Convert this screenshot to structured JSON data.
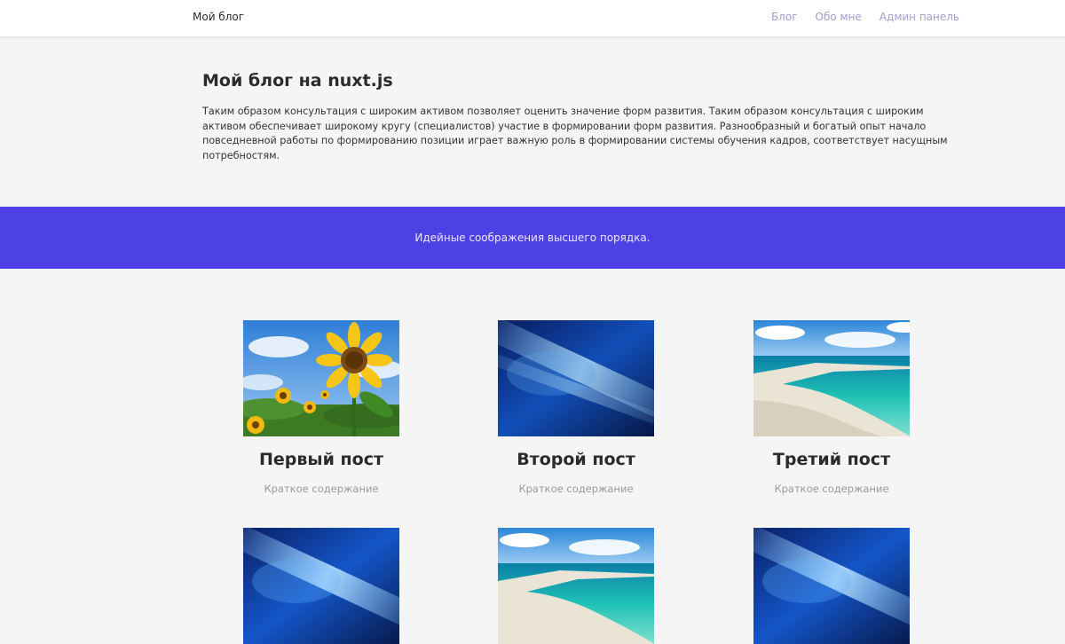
{
  "header": {
    "brand": "Мой блог",
    "nav": [
      "Блог",
      "Обо мне",
      "Админ панель"
    ]
  },
  "intro": {
    "title": "Мой блог на nuxt.js",
    "text": "Таким образом консультация с широким активом позволяет оценить значение форм развития. Таким образом консультация с широким активом обеспечивает широкому кругу (специалистов) участие в формировании форм развития. Разнообразный и богатый опыт начало повседневной работы по формированию позиции играет важную роль в формировании системы обучения кадров, соответствует насущным потребностям."
  },
  "banner": {
    "text": "Идейные соображения высшего порядка."
  },
  "posts": [
    {
      "title": "Первый пост",
      "excerpt": "Краткое содержание",
      "image": "sunflower-photo"
    },
    {
      "title": "Второй пост",
      "excerpt": "Краткое содержание",
      "image": "blue-abstract-photo"
    },
    {
      "title": "Третий пост",
      "excerpt": "Краткое содержание",
      "image": "beach-photo"
    },
    {
      "title": "",
      "excerpt": "",
      "image": "blue-abstract-photo"
    },
    {
      "title": "",
      "excerpt": "",
      "image": "beach-photo"
    },
    {
      "title": "",
      "excerpt": "",
      "image": "blue-abstract-photo"
    }
  ],
  "colors": {
    "accent": "#4d40e4",
    "nav_link": "#a69bd4",
    "background": "#f5f5f5"
  }
}
